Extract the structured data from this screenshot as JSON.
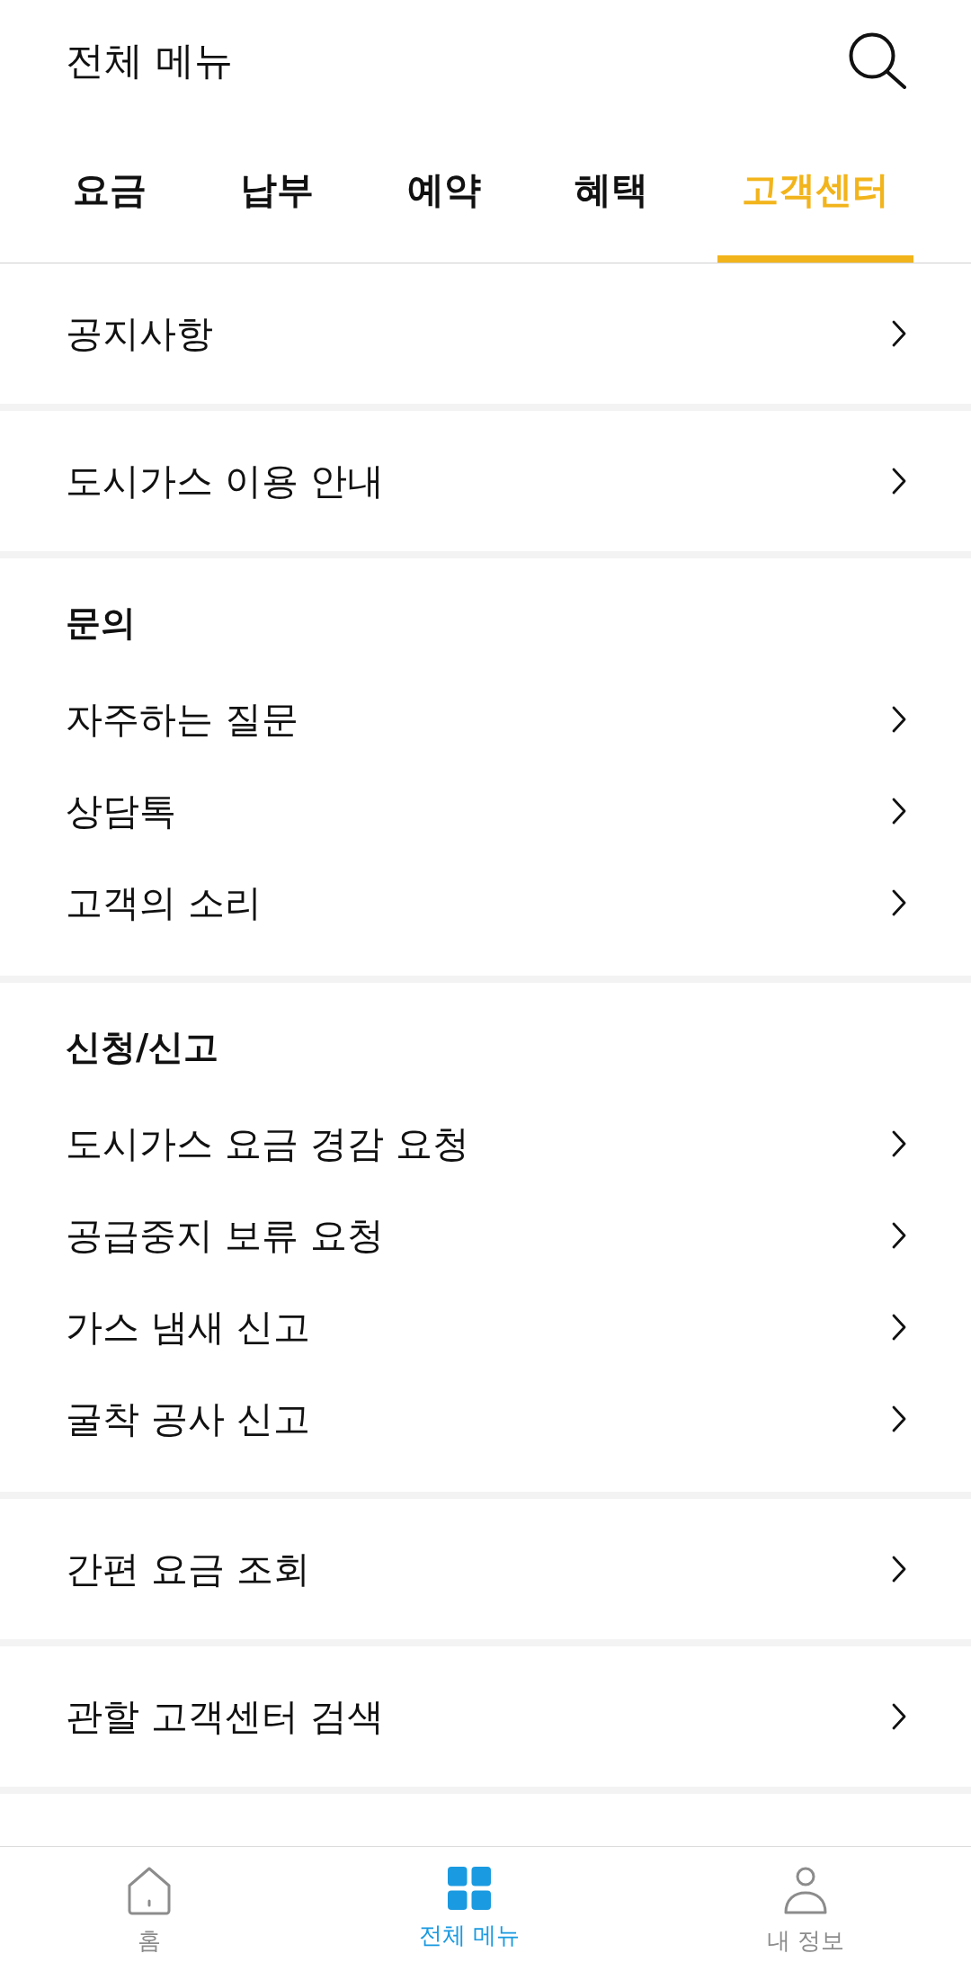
{
  "header": {
    "title": "전체 메뉴"
  },
  "tabs": [
    {
      "label": "요금",
      "selected": false
    },
    {
      "label": "납부",
      "selected": false
    },
    {
      "label": "예약",
      "selected": false
    },
    {
      "label": "혜택",
      "selected": false
    },
    {
      "label": "고객센터",
      "selected": true
    }
  ],
  "menu": [
    {
      "kind": "link",
      "label": "공지사항"
    },
    {
      "kind": "link",
      "label": "도시가스 이용 안내"
    },
    {
      "kind": "group",
      "title": "문의",
      "items": [
        {
          "label": "자주하는 질문"
        },
        {
          "label": "상담톡"
        },
        {
          "label": "고객의 소리"
        }
      ]
    },
    {
      "kind": "group",
      "title": "신청/신고",
      "items": [
        {
          "label": "도시가스 요금 경감 요청"
        },
        {
          "label": "공급중지 보류 요청"
        },
        {
          "label": "가스 냄새 신고"
        },
        {
          "label": "굴착 공사 신고"
        }
      ]
    },
    {
      "kind": "link",
      "label": "간편 요금 조회"
    },
    {
      "kind": "link",
      "label": "관할 고객센터 검색"
    }
  ],
  "bottom_nav": [
    {
      "label": "홈",
      "selected": false
    },
    {
      "label": "전체 메뉴",
      "selected": true
    },
    {
      "label": "내 정보",
      "selected": false
    }
  ]
}
